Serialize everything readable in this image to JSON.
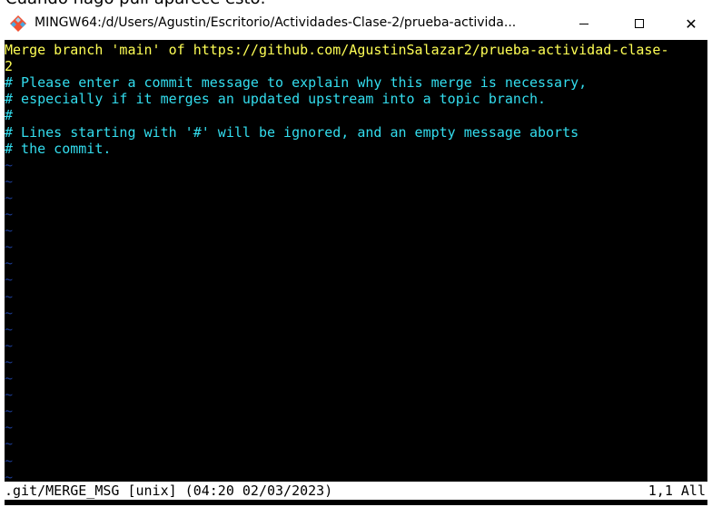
{
  "caption": {
    "text": "Cuando hago pull aparece esto:"
  },
  "window": {
    "title": "MINGW64:/d/Users/Agustin/Escritorio/Actividades-Clase-2/prueba-activida...",
    "icon": "git-bash-icon",
    "controls": {
      "minimize": "minimize-icon",
      "maximize": "maximize-icon",
      "close": "✕"
    }
  },
  "editor": {
    "lines": [
      {
        "text": "Merge branch 'main' of https://github.com/AgustinSalazar2/prueba-actividad-clase-",
        "kind": "yellow"
      },
      {
        "text": "2",
        "kind": "yellow"
      },
      {
        "text": "# Please enter a commit message to explain why this merge is necessary,",
        "kind": "cyan"
      },
      {
        "text": "# especially if it merges an updated upstream into a topic branch.",
        "kind": "cyan"
      },
      {
        "text": "#",
        "kind": "cyan"
      },
      {
        "text": "# Lines starting with '#' will be ignored, and an empty message aborts",
        "kind": "cyan"
      },
      {
        "text": "# the commit.",
        "kind": "cyan"
      },
      {
        "text": "~",
        "kind": "tilde"
      },
      {
        "text": "~",
        "kind": "tilde"
      },
      {
        "text": "~",
        "kind": "tilde"
      },
      {
        "text": "~",
        "kind": "tilde"
      },
      {
        "text": "~",
        "kind": "tilde"
      },
      {
        "text": "~",
        "kind": "tilde"
      },
      {
        "text": "~",
        "kind": "tilde"
      },
      {
        "text": "~",
        "kind": "tilde"
      },
      {
        "text": "~",
        "kind": "tilde"
      },
      {
        "text": "~",
        "kind": "tilde"
      },
      {
        "text": "~",
        "kind": "tilde"
      },
      {
        "text": "~",
        "kind": "tilde"
      },
      {
        "text": "~",
        "kind": "tilde"
      },
      {
        "text": "~",
        "kind": "tilde"
      },
      {
        "text": "~",
        "kind": "tilde"
      },
      {
        "text": "~",
        "kind": "tilde"
      },
      {
        "text": "~",
        "kind": "tilde"
      },
      {
        "text": "~",
        "kind": "tilde"
      },
      {
        "text": "~",
        "kind": "tilde"
      },
      {
        "text": "~",
        "kind": "tilde"
      },
      {
        "text": "~",
        "kind": "tilde"
      }
    ],
    "status_left": ".git/MERGE_MSG [unix] (04:20 02/03/2023)",
    "status_right": "1,1 All"
  }
}
